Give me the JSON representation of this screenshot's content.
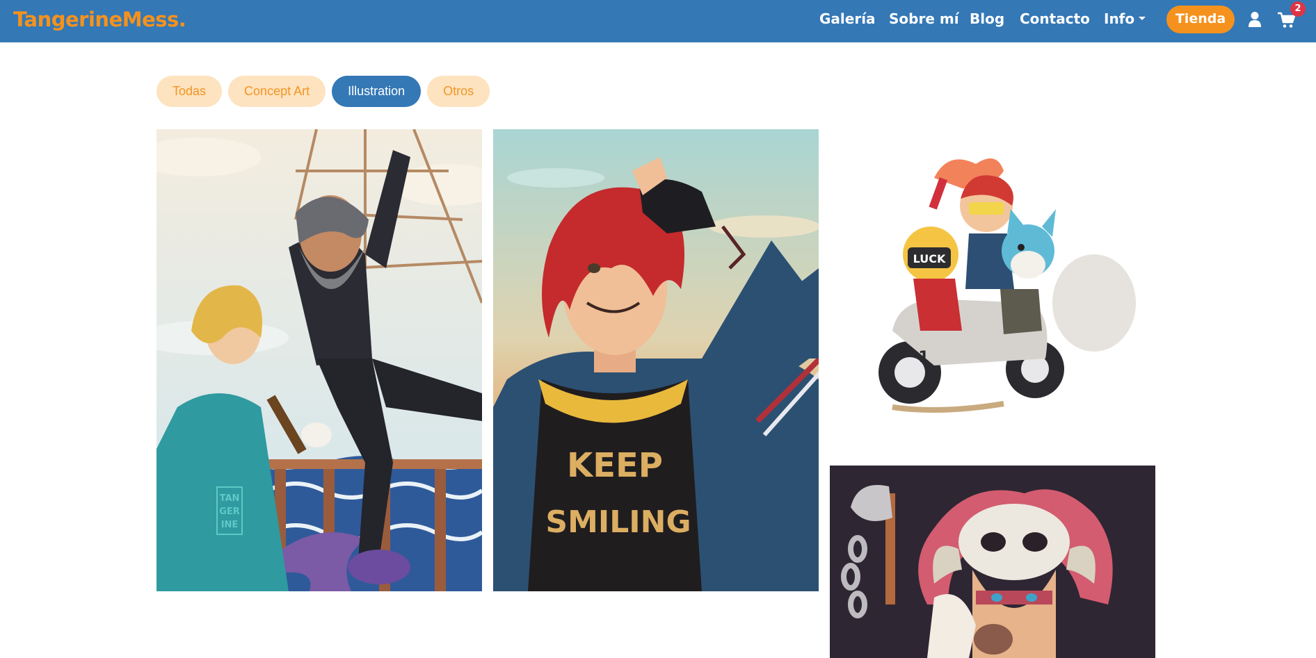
{
  "brand": {
    "name": "TangerineMess."
  },
  "nav": {
    "items": [
      {
        "label": "Galería"
      },
      {
        "label": "Sobre mí"
      },
      {
        "label": "Blog"
      },
      {
        "label": "Contacto"
      },
      {
        "label": "Info"
      }
    ],
    "shop_label": "Tienda",
    "cart_count": "2",
    "icons": {
      "user": "user-icon",
      "cart": "cart-icon",
      "dropdown": "caret-down-icon"
    }
  },
  "filters": {
    "items": [
      {
        "label": "Todas",
        "active": false
      },
      {
        "label": "Concept Art",
        "active": false
      },
      {
        "label": "Illustration",
        "active": true
      },
      {
        "label": "Otros",
        "active": false
      }
    ]
  },
  "gallery": {
    "artworks": [
      {
        "watermark": [
          "TAN",
          "GER",
          "INE"
        ]
      },
      {
        "shirt_text": [
          "KEEP",
          "SMILING"
        ]
      },
      {
        "plate_text": "LUCK",
        "number": "1"
      },
      {}
    ]
  },
  "colors": {
    "navbar": "#3478b6",
    "accent_orange": "#f5921d",
    "pill_inactive_bg": "#fde3bf",
    "pill_inactive_text": "#f29525",
    "badge_red": "#dc3545"
  }
}
